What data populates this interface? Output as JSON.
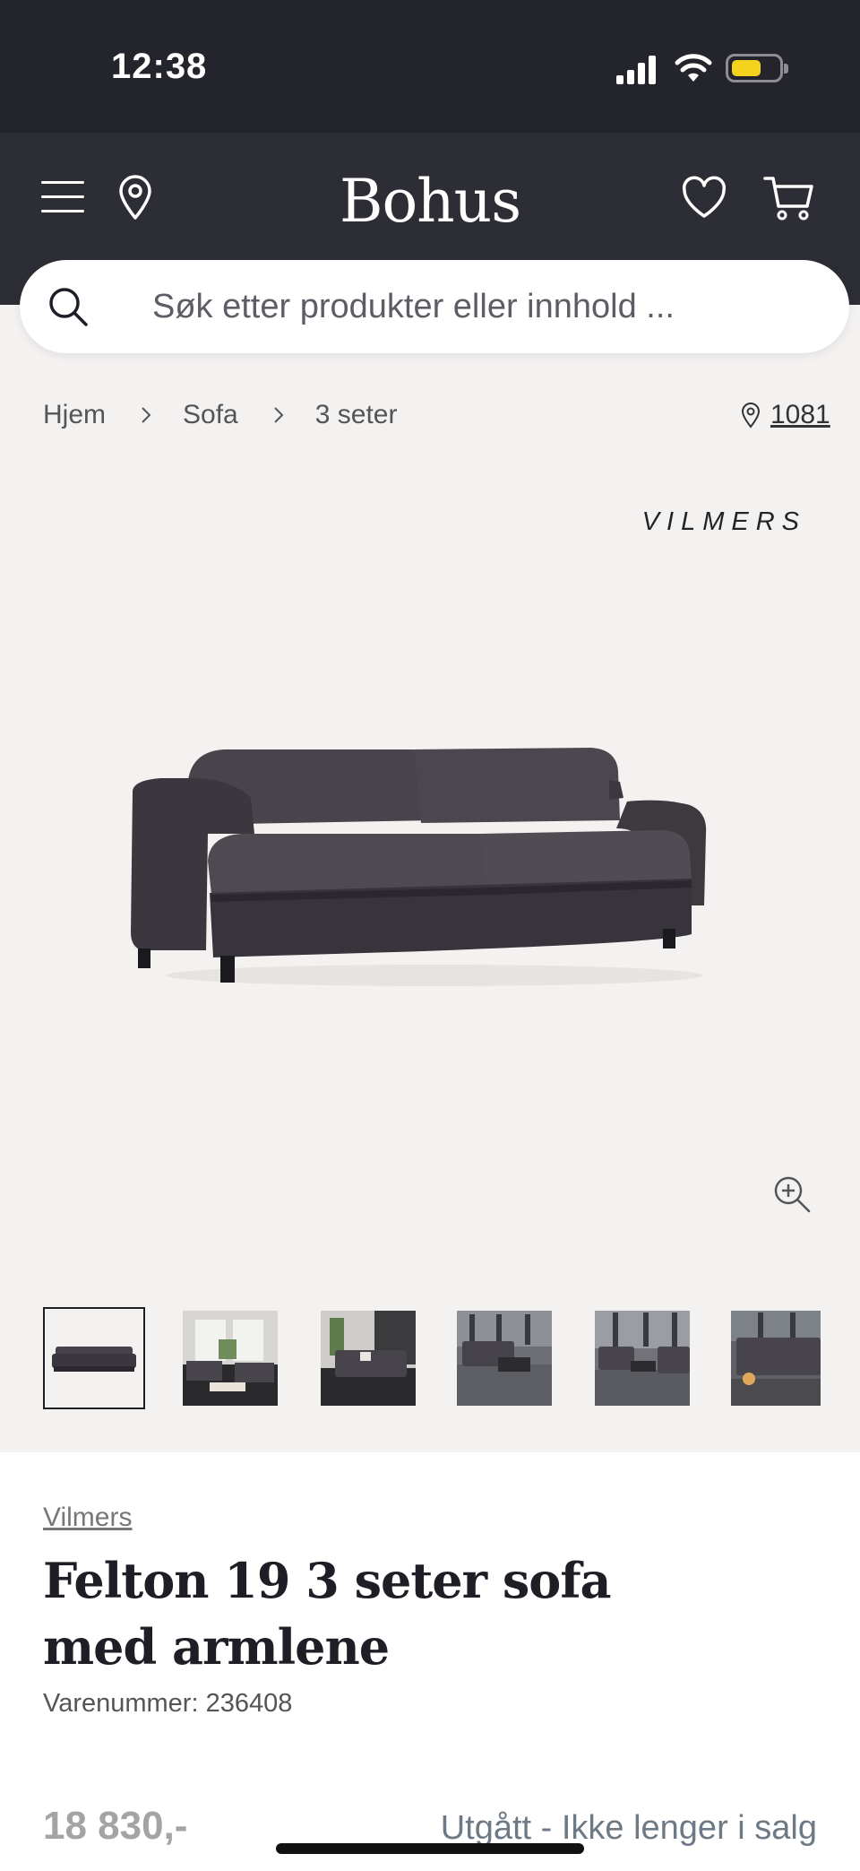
{
  "status_bar": {
    "time": "12:38"
  },
  "header": {
    "logo": "Bohus"
  },
  "search": {
    "placeholder": "Søk etter produkter eller innhold ..."
  },
  "breadcrumb": [
    "Hjem",
    "Sofa",
    "3 seter"
  ],
  "store": {
    "number": "1081"
  },
  "product": {
    "brand_logo": "VILMERS",
    "brand": "Vilmers",
    "title": "Felton 19 3 seter sofa med armlene",
    "sku": "Varenummer: 236408",
    "price": "18 830,-",
    "availability": "Utgått - Ikke lenger i salg",
    "thumbnail_count": 6,
    "active_thumbnail": 1
  },
  "colors": {
    "header_bg": "#2c2d35",
    "status_bg": "#24252c",
    "page_bg": "#f4f2f1",
    "battery": "#f5d21b",
    "sofa": "#3e3b42"
  }
}
